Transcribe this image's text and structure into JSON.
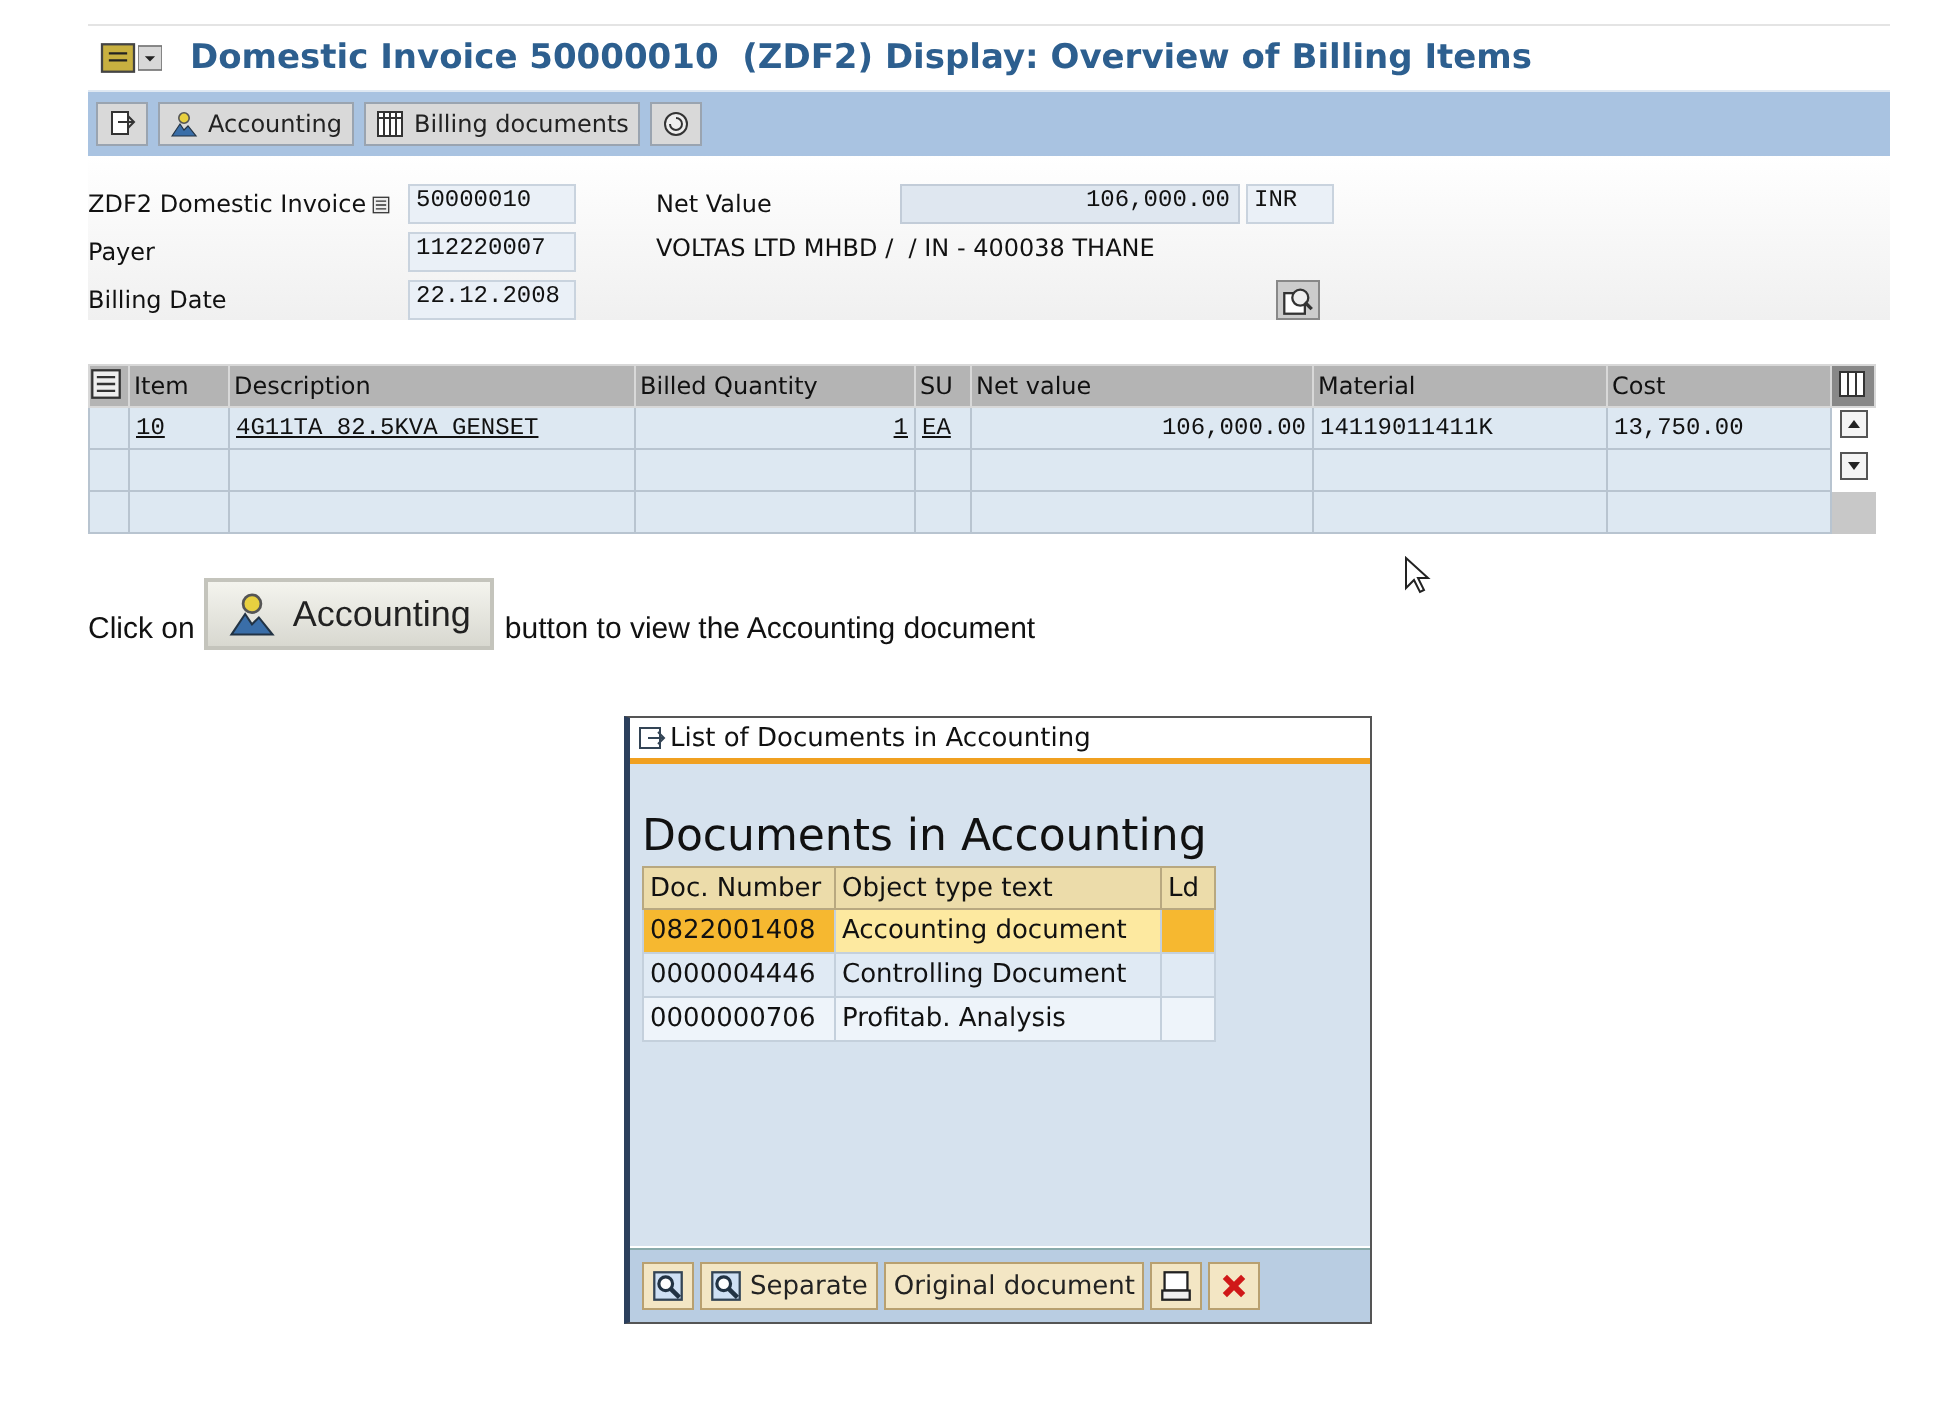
{
  "screen": {
    "title": "Domestic Invoice 50000010  (ZDF2) Display: Overview of Billing Items",
    "toolbar": [
      {
        "kind": "document"
      },
      {
        "kind": "person",
        "label": "Accounting"
      },
      {
        "kind": "grid",
        "label": "Billing documents"
      },
      {
        "kind": "circle"
      }
    ],
    "fields": [
      {
        "label": "ZDF2 Domestic Invoice",
        "value": "50000010"
      },
      {
        "label": "Payer",
        "value": "112220007"
      },
      {
        "label": "Billing Date",
        "value": "22.12.2008"
      }
    ],
    "net_value": {
      "label": "Net Value",
      "value": "106,000.00",
      "currency": "INR"
    },
    "payer_address": "VOLTAS LTD MHBD /  / IN - 400038 THANE",
    "table": {
      "columns": [
        {
          "label": "Item",
          "kind": "link"
        },
        {
          "label": "Description",
          "kind": "link"
        },
        {
          "label": "Billed Quantity",
          "kind": "link-number"
        },
        {
          "label": "SU",
          "kind": "link"
        },
        {
          "label": "Net value",
          "kind": "number"
        },
        {
          "label": "Material",
          "kind": "text"
        },
        {
          "label": "Cost",
          "kind": "text"
        }
      ],
      "rows": [
        [
          "10",
          "4G11TA 82.5KVA GENSET",
          "1",
          "EA",
          "106,000.00",
          "14119011411K",
          "13,750.00"
        ]
      ]
    }
  },
  "instruction": {
    "before": "Click on",
    "button": "Accounting",
    "after": "button to view the Accounting document"
  },
  "popup": {
    "title": "List of Documents in Accounting",
    "heading": "Documents in Accounting",
    "columns": [
      "Doc. Number",
      "Object type text",
      "Ld"
    ],
    "rows": [
      {
        "number": "0822001408",
        "text": "Accounting document",
        "selected": true
      },
      {
        "number": "0000004446",
        "text": "Controlling Document",
        "selected": false
      },
      {
        "number": "0000000706",
        "text": "Profitab. Analysis",
        "selected": false
      }
    ],
    "buttons": [
      {
        "kind": "zoom"
      },
      {
        "kind": "zoom",
        "label": "Separate"
      },
      {
        "kind": "text",
        "label": "Original document"
      },
      {
        "kind": "print"
      },
      {
        "kind": "cancel"
      }
    ]
  }
}
